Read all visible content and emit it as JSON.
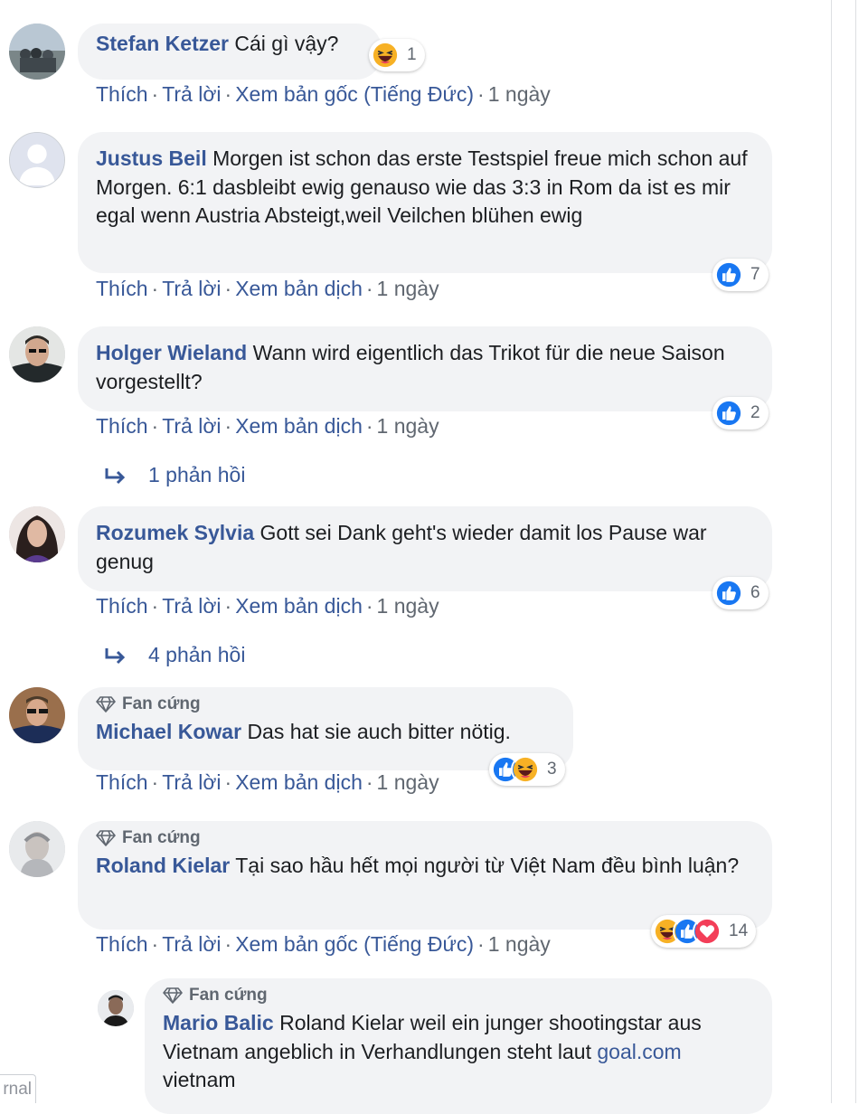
{
  "actions": {
    "like": "Thích",
    "reply": "Trả lời",
    "see_translation": "Xem bản dịch",
    "see_original": "Xem bản gốc (Tiếng Đức)",
    "sep": "·"
  },
  "comments": [
    {
      "author": "Stefan Ketzer",
      "text": "Cái gì vậy?",
      "action3": "Xem bản gốc (Tiếng Đức)",
      "time": "1 ngày",
      "reactions": {
        "icons": [
          "haha-icon"
        ],
        "count": "1"
      }
    },
    {
      "author": "Justus Beil",
      "text": "Morgen ist schon das erste Testspiel freue mich schon auf Morgen. 6:1 dasbleibt ewig genauso wie das 3:3 in Rom da ist es mir egal wenn Austria Absteigt,weil Veilchen blühen ewig",
      "action3": "Xem bản dịch",
      "time": "1 ngày",
      "reactions": {
        "icons": [
          "like-icon"
        ],
        "count": "7"
      }
    },
    {
      "author": "Holger Wieland",
      "text": "Wann wird eigentlich das Trikot für die neue Saison vorgestellt?",
      "action3": "Xem bản dịch",
      "time": "1 ngày",
      "reactions": {
        "icons": [
          "like-icon"
        ],
        "count": "2"
      },
      "replies": "1 phản hồi"
    },
    {
      "author": "Rozumek Sylvia",
      "text": "Gott sei Dank geht's wieder damit los Pause war genug",
      "action3": "Xem bản dịch",
      "time": "1 ngày",
      "reactions": {
        "icons": [
          "like-icon"
        ],
        "count": "6"
      },
      "replies": "4 phản hồi"
    },
    {
      "badge": "Fan cứng",
      "author": "Michael Kowar",
      "text": "Das hat sie auch bitter nötig.",
      "action3": "Xem bản dịch",
      "time": "1 ngày",
      "reactions": {
        "icons": [
          "like-icon",
          "haha-icon"
        ],
        "count": "3"
      }
    },
    {
      "badge": "Fan cứng",
      "author": "Roland Kielar",
      "text": "Tại sao hầu hết mọi người từ Việt Nam đều bình luận?",
      "action3": "Xem bản gốc (Tiếng Đức)",
      "time": "1 ngày",
      "reactions": {
        "icons": [
          "haha-icon",
          "like-icon",
          "love-icon"
        ],
        "count": "14"
      }
    }
  ],
  "nested_reply": {
    "badge": "Fan cứng",
    "author": "Mario Balic",
    "text_before": "Roland Kielar weil ein junger shootingstar aus Vietnam angeblich in Verhandlungen steht laut",
    "link": "goal.com",
    "text_after": "vietnam"
  },
  "cut_label": "rnal",
  "colors": {
    "link": "#385898",
    "meta": "#606770",
    "bubble": "#f2f3f5",
    "like": "#1877f2",
    "love": "#f33e58",
    "haha": "#f7b125"
  }
}
